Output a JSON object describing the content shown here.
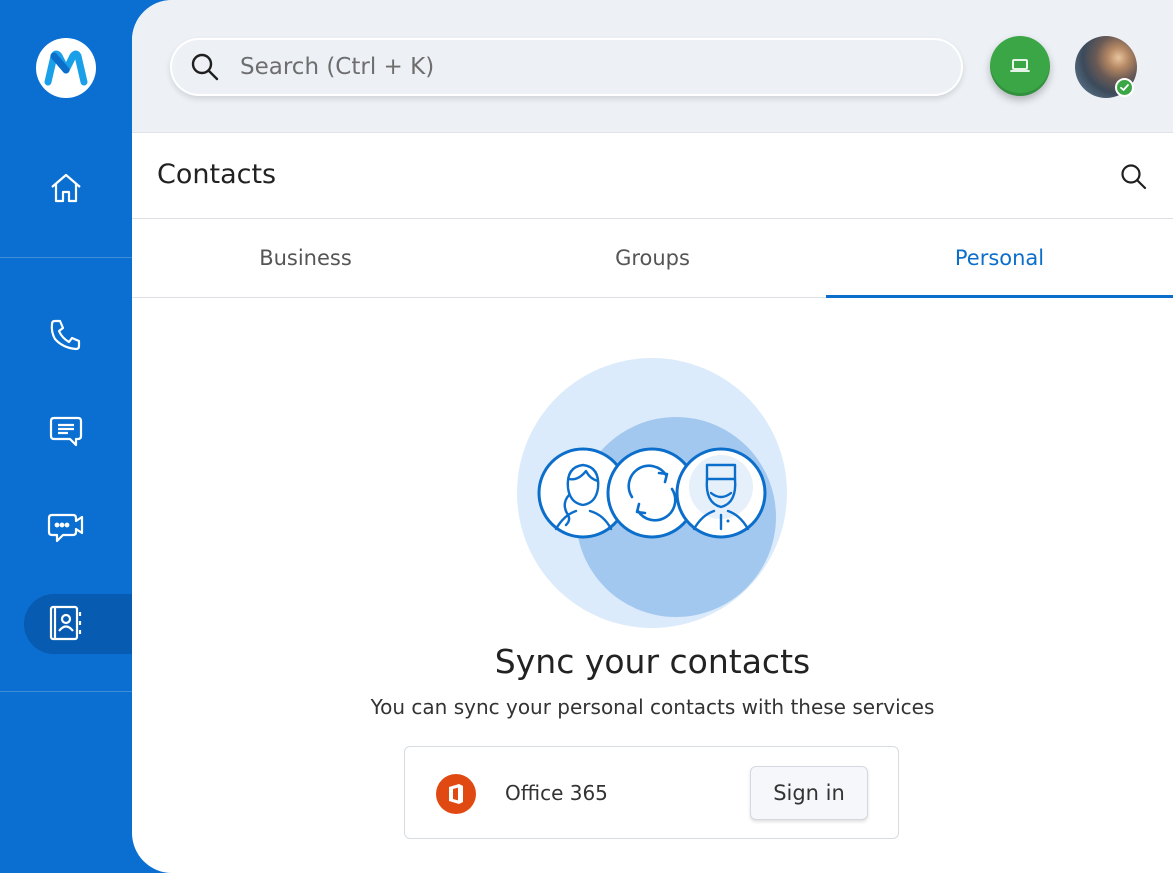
{
  "sidebar": {
    "logo_icon": "m-logo-icon",
    "items": [
      {
        "name": "home",
        "icon": "home-icon"
      },
      {
        "name": "calls",
        "icon": "phone-icon"
      },
      {
        "name": "chat",
        "icon": "chat-icon"
      },
      {
        "name": "meetings",
        "icon": "video-chat-icon"
      },
      {
        "name": "contacts",
        "icon": "contacts-book-icon",
        "active": true
      }
    ]
  },
  "topbar": {
    "search_placeholder": "Search (Ctrl + K)",
    "device_button_icon": "laptop-icon",
    "avatar_status": "online"
  },
  "page": {
    "title": "Contacts"
  },
  "tabs": [
    {
      "label": "Business",
      "active": false
    },
    {
      "label": "Groups",
      "active": false
    },
    {
      "label": "Personal",
      "active": true
    }
  ],
  "empty_state": {
    "title": "Sync your contacts",
    "subtitle": "You can sync your personal contacts with these services",
    "services": [
      {
        "name": "Office 365",
        "icon": "office365-icon",
        "action_label": "Sign in"
      }
    ]
  },
  "colors": {
    "brand": "#0a6fd0",
    "accent": "#0b6ecb",
    "green": "#3aa646",
    "office": "#e04a12"
  }
}
